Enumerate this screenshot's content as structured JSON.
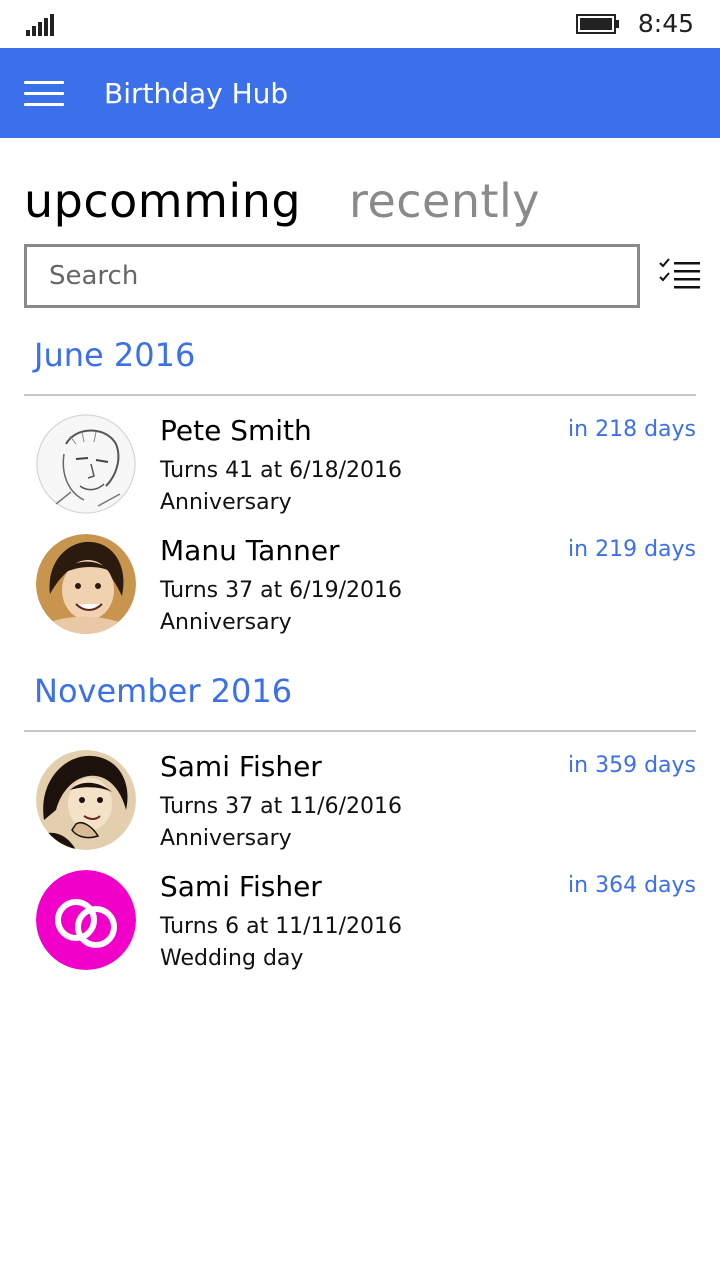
{
  "status_bar": {
    "time": "8:45",
    "signal_icon": "signal-bars-icon",
    "battery_icon": "battery-full-icon"
  },
  "app_bar": {
    "title": "Birthday Hub",
    "menu_icon": "hamburger-menu-icon",
    "background_color": "#3b70ea"
  },
  "tabs": [
    {
      "label": "upcomming",
      "active": true
    },
    {
      "label": "recently",
      "active": false
    }
  ],
  "search": {
    "placeholder": "Search",
    "value": ""
  },
  "select_icon": "multi-select-checklist-icon",
  "accent_color": "#3b70ea",
  "groups": [
    {
      "header": "June 2016",
      "items": [
        {
          "name": "Pete Smith",
          "turns": "Turns 41 at 6/18/2016",
          "event": "Anniversary",
          "days": "in 218 days",
          "avatar": "sketch-portrait-man"
        },
        {
          "name": "Manu Tanner",
          "turns": "Turns 37 at 6/19/2016",
          "event": "Anniversary",
          "days": "in 219 days",
          "avatar": "sepia-portrait-woman"
        }
      ]
    },
    {
      "header": "November 2016",
      "items": [
        {
          "name": "Sami Fisher",
          "turns": "Turns 37 at 11/6/2016",
          "event": "Anniversary",
          "days": "in 359 days",
          "avatar": "sepia-portrait-woman-dark-hair"
        },
        {
          "name": "Sami Fisher",
          "turns": "Turns 6 at 11/11/2016",
          "event": "Wedding day",
          "days": "in 364 days",
          "avatar": "wedding-rings-magenta"
        }
      ]
    }
  ]
}
